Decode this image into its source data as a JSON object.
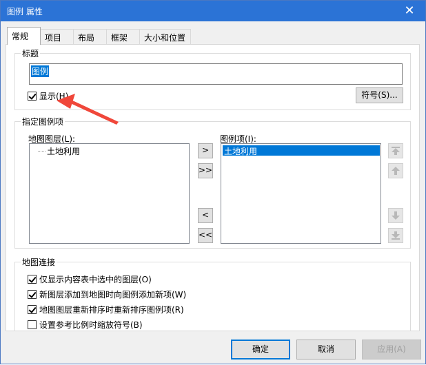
{
  "window": {
    "title": "图例 属性",
    "close_glyph": "✕"
  },
  "tabs": [
    "常规",
    "项目",
    "布局",
    "框架",
    "大小和位置"
  ],
  "title_group": {
    "label": "标题",
    "value": "图例",
    "show_label": "显示(H)",
    "show_checked": true,
    "symbol_button": "符号(S)..."
  },
  "items_group": {
    "label": "指定图例项",
    "map_layers_label": "地图图层(L):",
    "map_layers": [
      "土地利用"
    ],
    "legend_items_label": "图例项(I):",
    "legend_items": [
      "土地利用"
    ],
    "buttons": {
      "add": ">",
      "add_all": ">>",
      "remove": "<",
      "remove_all": "<<"
    },
    "move_icons": [
      "move-top-icon",
      "move-up-icon",
      "move-down-icon",
      "move-bottom-icon"
    ]
  },
  "link_group": {
    "label": "地图连接",
    "options": [
      {
        "label": "仅显示内容表中选中的图层(O)",
        "checked": true
      },
      {
        "label": "新图层添加到地图时向图例添加新项(W)",
        "checked": true
      },
      {
        "label": "地图图层重新排序时重新排序图例项(R)",
        "checked": true
      },
      {
        "label": "设置参考比例时缩放符号(B)",
        "checked": false
      }
    ]
  },
  "footer": {
    "ok": "确定",
    "cancel": "取消",
    "apply": "应用(A)"
  },
  "colors": {
    "titlebar": "#2b73d6",
    "selection": "#0078d7",
    "annotation_arrow": "#f0473a"
  }
}
